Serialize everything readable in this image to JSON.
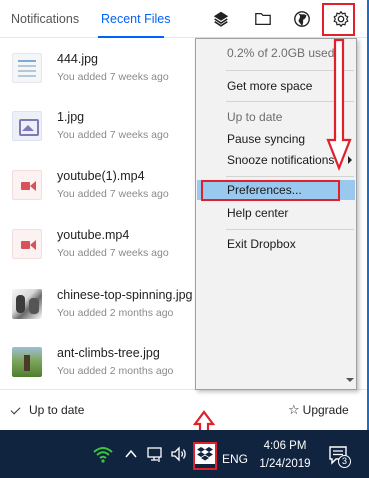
{
  "tabs": {
    "notifications": "Notifications",
    "recent_files": "Recent Files",
    "active": "recent_files"
  },
  "toolbar": {
    "icons": [
      "layers-icon",
      "folder-icon",
      "globe-icon",
      "gear-icon"
    ]
  },
  "files": [
    {
      "name": "444.jpg",
      "meta": "You added 7 weeks ago",
      "thumb": "doc"
    },
    {
      "name": "1.jpg",
      "meta": "You added 7 weeks ago",
      "thumb": "image"
    },
    {
      "name": "youtube(1).mp4",
      "meta": "You added 7 weeks ago",
      "thumb": "video"
    },
    {
      "name": "youtube.mp4",
      "meta": "You added 7 weeks ago",
      "thumb": "video"
    },
    {
      "name": "chinese-top-spinning.jpg",
      "meta": "You added 2 months ago",
      "thumb": "photo"
    },
    {
      "name": "ant-climbs-tree.jpg",
      "meta": "You added 2 months ago",
      "thumb": "photo"
    }
  ],
  "footer": {
    "status": "Up to date",
    "upgrade": "Upgrade"
  },
  "menu": {
    "usage": "0.2% of 2.0GB used",
    "get_more_space": "Get more space",
    "sync_status": "Up to date",
    "pause_syncing": "Pause syncing",
    "snooze_notifications": "Snooze notifications",
    "preferences": "Preferences...",
    "help_center": "Help center",
    "exit": "Exit Dropbox",
    "selected_item": "preferences"
  },
  "taskbar": {
    "language": "ENG",
    "time": "4:06 PM",
    "date": "1/24/2019",
    "notification_count": "3"
  },
  "colors": {
    "accent": "#0061fe",
    "highlight_annotation": "#e0202a",
    "menu_selected": "#99c9ef",
    "taskbar_bg": "#10243f",
    "wifi_green": "#3ec43e"
  }
}
